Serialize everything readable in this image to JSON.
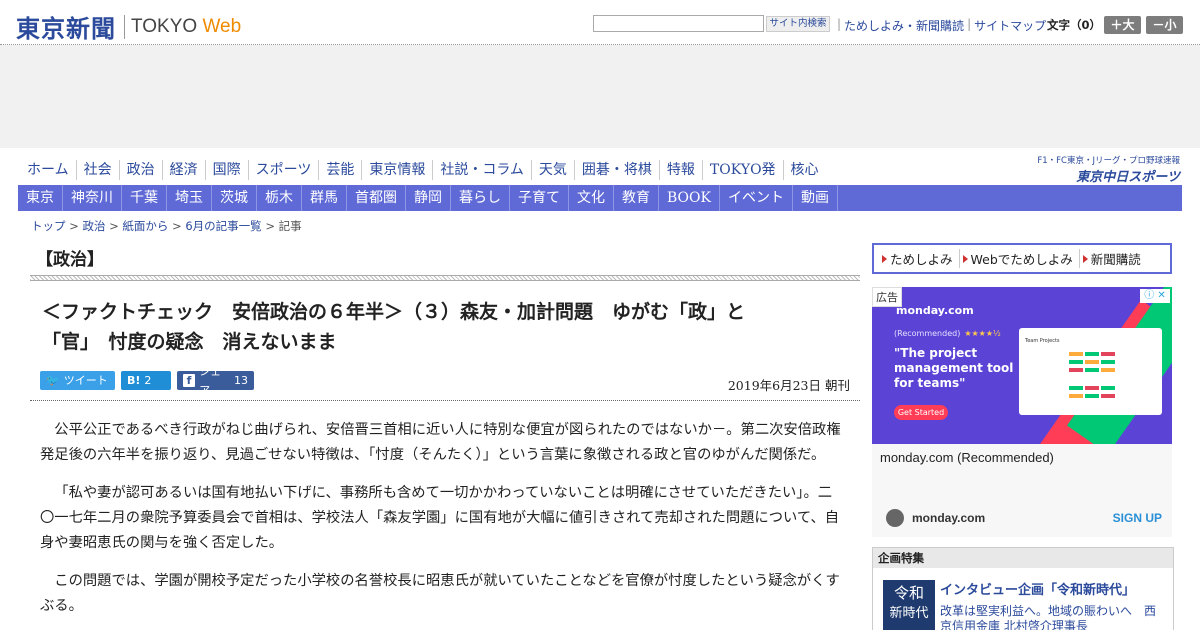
{
  "header": {
    "logo_jp": "東京新聞",
    "logo_en_1": "TOKYO",
    "logo_en_2": "Web",
    "search_button": "サイト内検索",
    "links": [
      "ためしよみ・新聞購読",
      "サイトマップ"
    ],
    "font_size_label": "文字（0）",
    "font_big": "＋大",
    "font_small": "－小"
  },
  "main_nav": [
    "ホーム",
    "社会",
    "政治",
    "経済",
    "国際",
    "スポーツ",
    "芸能",
    "東京情報",
    "社説・コラム",
    "天気",
    "囲碁・将棋",
    "特報",
    "TOKYO発",
    "核心"
  ],
  "chunichi": {
    "line1": "F1・FC東京・Jリーグ・プロ野球速報",
    "line2": "東京中日スポーツ"
  },
  "sub_nav": [
    "東京",
    "神奈川",
    "千葉",
    "埼玉",
    "茨城",
    "栃木",
    "群馬",
    "首都圏",
    "静岡",
    "暮らし",
    "子育て",
    "文化",
    "教育",
    "BOOK",
    "イベント",
    "動画"
  ],
  "breadcrumb": [
    "トップ",
    "政治",
    "紙面から",
    "6月の記事一覧",
    "記事"
  ],
  "article": {
    "category": "【政治】",
    "headline_1": "＜ファクトチェック　安倍政治の６年半＞（３）森友・加計問題　ゆがむ「政」と",
    "headline_2": "「官」　忖度の疑念　消えないまま",
    "tweet": "ツイート",
    "hatena_count": "2",
    "share": "シェア",
    "share_count": "13",
    "date": "2019年6月23日 朝刊",
    "paragraphs": [
      "公平公正であるべき行政がねじ曲げられ、安倍晋三首相に近い人に特別な便宜が図られたのではないか－。第二次安倍政権発足後の六年半を振り返り、見過ごせない特徴は、「忖度（そんたく）」という言葉に象徴される政と官のゆがんだ関係だ。",
      "「私や妻が認可あるいは国有地払い下げに、事務所も含めて一切かかわっていないことは明確にさせていただきたい」。二〇一七年二月の衆院予算委員会で首相は、学校法人「森友学園」に国有地が大幅に値引きされて売却された問題について、自身や妻昭恵氏の関与を強く否定した。",
      "この問題では、学園が開校予定だった小学校の名誉校長に昭恵氏が就いていたことなどを官僚が忖度したという疑念がくすぶる。"
    ]
  },
  "sidebar": {
    "tameshi": [
      "ためしよみ",
      "Webでためしよみ",
      "新聞購読"
    ],
    "ad": {
      "label": "広告",
      "brand": "monday.com",
      "recommended": "(Recommended)",
      "stars": "★★★★½",
      "quote": "\"The project management tool for teams\"",
      "cta": "Get Started",
      "panel_title": "Team Projects",
      "name": "monday.com (Recommended)",
      "footer": "monday.com",
      "signup": "SIGN UP"
    },
    "feature": {
      "header": "企画特集",
      "img_1": "令和",
      "img_2": "新時代",
      "title": "インタビュー企画「令和新時代」",
      "sub": "改革は堅実利益へ。地域の賑わいへ　西京信用金庫 北村啓介理事長"
    }
  }
}
